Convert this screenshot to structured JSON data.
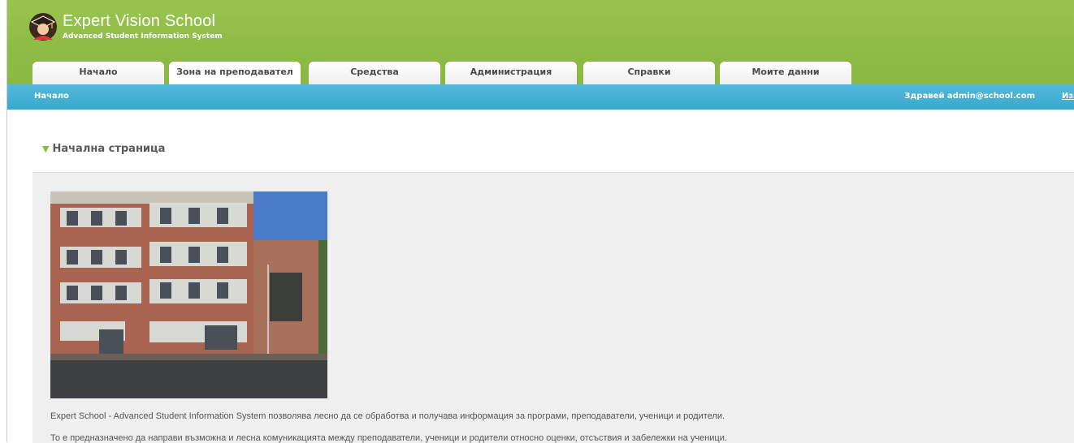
{
  "app": {
    "title": "Expert Vision School",
    "subtitle": "Advanced Student Information System"
  },
  "tabs": [
    {
      "label": "Начало"
    },
    {
      "label": "Зона на преподавател"
    },
    {
      "label": "Средства"
    },
    {
      "label": "Администрация"
    },
    {
      "label": "Справки"
    },
    {
      "label": "Моите данни"
    }
  ],
  "bar": {
    "breadcrumb": "Начало",
    "greeting": "Здравей admin@school.com",
    "logout_label": "Изл"
  },
  "main": {
    "section_title": "Начална страница",
    "paragraphs": [
      "Expert School - Advanced Student Information System позволява лесно да се обработва и получава информация за програми, преподаватели, ученици и родители.",
      "То е предназначено да направи възможна и лесна комуникацията между преподаватели, ученици и родители относно оценки, отсъствия и забележки на ученици."
    ]
  },
  "colors": {
    "header_green": "#8dbb45",
    "bar_blue": "#45b0d4",
    "content_gray": "#efefef"
  },
  "icons": {
    "logo": "graduate-student-icon",
    "section_marker": "triangle-down-icon"
  }
}
